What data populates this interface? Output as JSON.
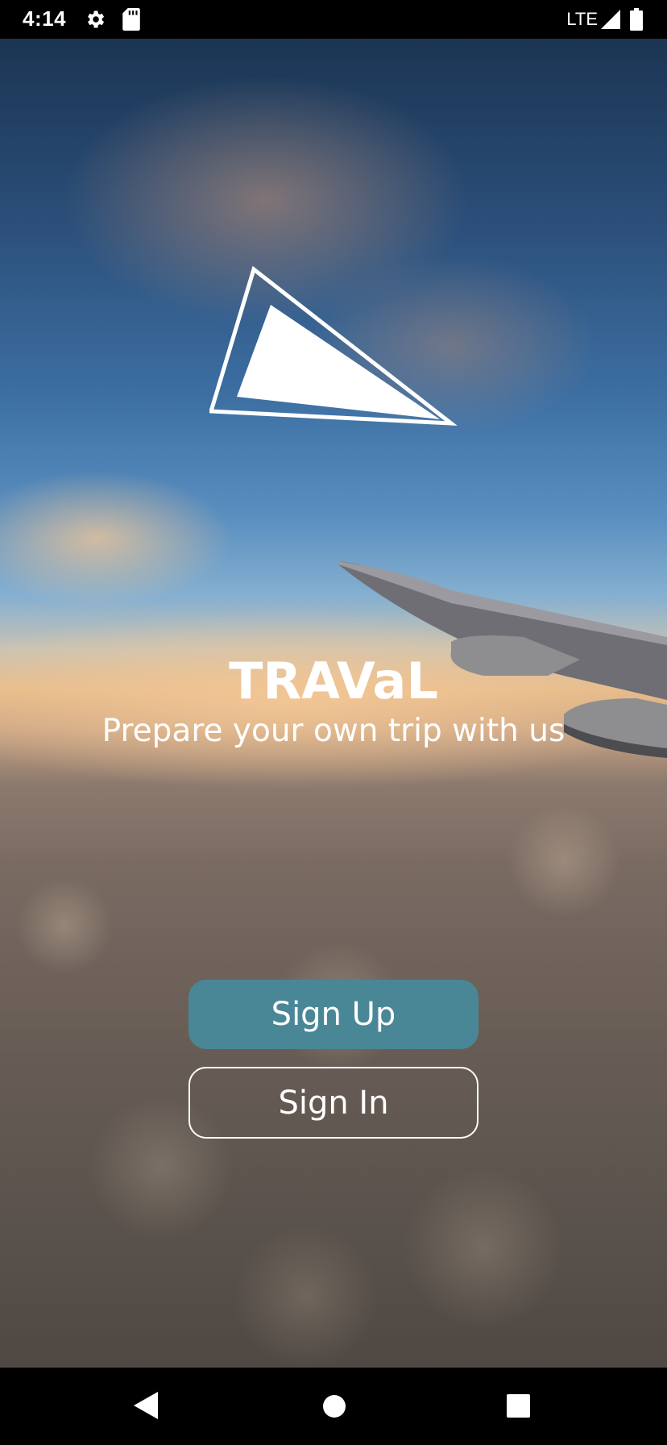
{
  "status_bar": {
    "time": "4:14",
    "network": "LTE",
    "icons": [
      "gear-icon",
      "sd-card-icon",
      "signal-icon",
      "battery-icon"
    ]
  },
  "app": {
    "title": "TRAVaL",
    "tagline": "Prepare your own trip with us",
    "logo": "paper-plane-triangle-logo"
  },
  "buttons": {
    "signup_label": "Sign Up",
    "signin_label": "Sign In"
  },
  "nav_bar": {
    "icons": [
      "back-icon",
      "home-icon",
      "recents-icon"
    ]
  },
  "colors": {
    "signup_button": "#4a8796",
    "text": "#ffffff",
    "bars": "#000000"
  }
}
